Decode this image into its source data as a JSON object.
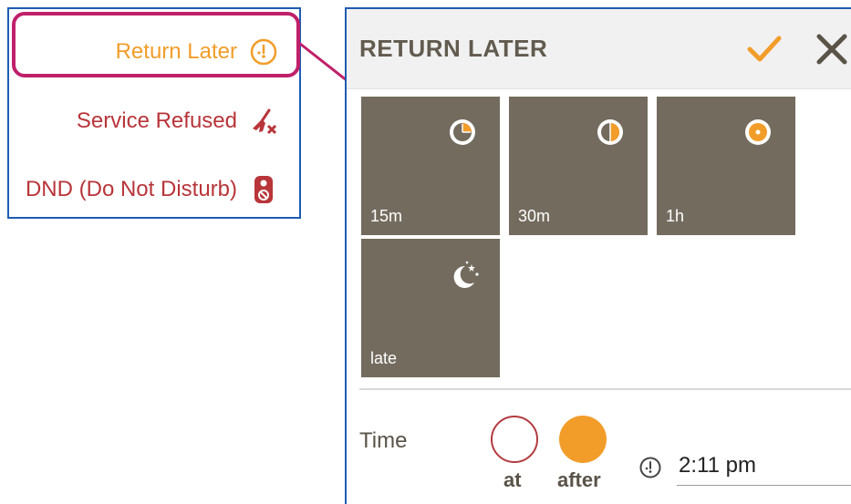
{
  "menu": {
    "items": [
      {
        "label": "Return Later",
        "icon": "clock-icon"
      },
      {
        "label": "Service Refused",
        "icon": "broom-cross-icon"
      },
      {
        "label": "DND (Do Not Disturb)",
        "icon": "door-hanger-icon"
      }
    ]
  },
  "dialog": {
    "title": "RETURN LATER",
    "confirm_icon": "checkmark-icon",
    "close_icon": "close-icon",
    "options": [
      {
        "label": "15m",
        "icon": "clock-quarter-icon"
      },
      {
        "label": "30m",
        "icon": "clock-half-icon"
      },
      {
        "label": "1h",
        "icon": "clock-full-icon"
      },
      {
        "label": "late",
        "icon": "moon-stars-icon"
      }
    ],
    "time": {
      "label": "Time",
      "mode_at": "at",
      "mode_after": "after",
      "value": "2:11 pm",
      "selected_mode": "after"
    }
  },
  "colors": {
    "accent_orange": "#f29d2a",
    "alert_red": "#b8353a",
    "highlight_magenta": "#c0206a",
    "tile_bg": "#736b5e",
    "frame_blue": "#1e5cb3"
  }
}
